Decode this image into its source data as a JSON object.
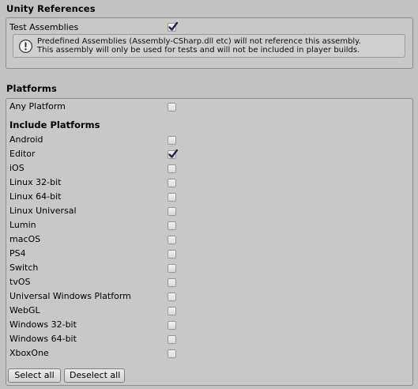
{
  "unity_references": {
    "title": "Unity References",
    "test_assemblies_label": "Test Assemblies",
    "test_assemblies_checked": true,
    "help_icon": "info-icon",
    "help_line1": "Predefined Assemblies (Assembly-CSharp.dll etc) will not reference this assembly.",
    "help_line2": "This assembly will only be used for tests and will not be included in player builds."
  },
  "platforms": {
    "title": "Platforms",
    "any_platform_label": "Any Platform",
    "any_platform_checked": false,
    "include_heading": "Include Platforms",
    "items": [
      {
        "label": "Android",
        "checked": false
      },
      {
        "label": "Editor",
        "checked": true
      },
      {
        "label": "iOS",
        "checked": false
      },
      {
        "label": "Linux 32-bit",
        "checked": false
      },
      {
        "label": "Linux 64-bit",
        "checked": false
      },
      {
        "label": "Linux Universal",
        "checked": false
      },
      {
        "label": "Lumin",
        "checked": false
      },
      {
        "label": "macOS",
        "checked": false
      },
      {
        "label": "PS4",
        "checked": false
      },
      {
        "label": "Switch",
        "checked": false
      },
      {
        "label": "tvOS",
        "checked": false
      },
      {
        "label": "Universal Windows Platform",
        "checked": false
      },
      {
        "label": "WebGL",
        "checked": false
      },
      {
        "label": "Windows 32-bit",
        "checked": false
      },
      {
        "label": "Windows 64-bit",
        "checked": false
      },
      {
        "label": "XboxOne",
        "checked": false
      }
    ],
    "select_all_label": "Select all",
    "deselect_all_label": "Deselect all"
  }
}
